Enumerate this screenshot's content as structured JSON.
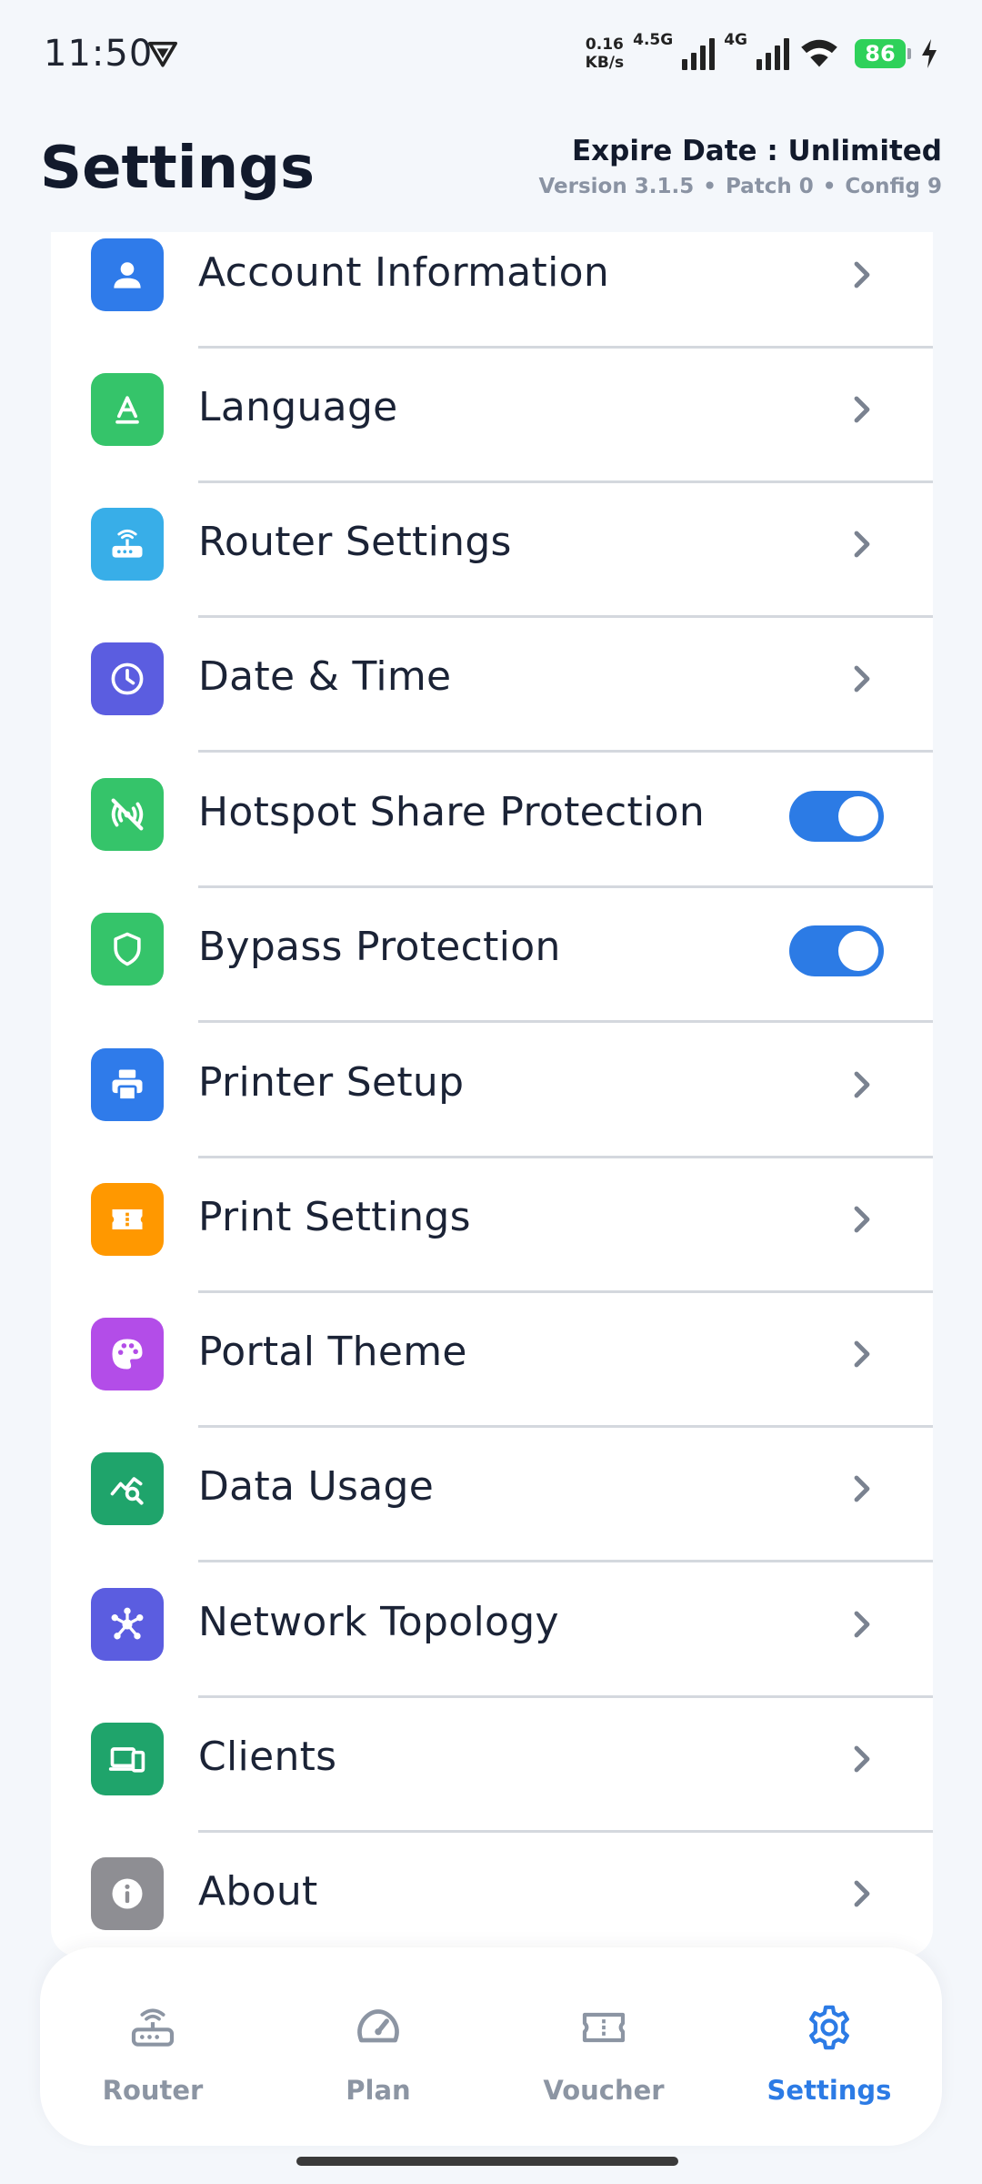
{
  "status_bar": {
    "time": "11:50",
    "net_speed_value": "0.16",
    "net_speed_unit": "KB/s",
    "signal1_label": "4.5G",
    "signal2_label": "4G",
    "battery_level": "86"
  },
  "header": {
    "title": "Settings",
    "expire": "Expire Date : Unlimited",
    "version": "Version 3.1.5",
    "patch": "Patch 0",
    "config": "Config 9",
    "separator": "•"
  },
  "settings": {
    "items": [
      {
        "label": "Account Information",
        "icon": "person-icon",
        "color": "#2f7bea",
        "control": "chevron"
      },
      {
        "label": "Language",
        "icon": "language-icon",
        "color": "#35c46a",
        "control": "chevron"
      },
      {
        "label": "Router Settings",
        "icon": "router-icon",
        "color": "#38aee8",
        "control": "chevron"
      },
      {
        "label": "Date & Time",
        "icon": "clock-icon",
        "color": "#5b5de0",
        "control": "chevron"
      },
      {
        "label": "Hotspot Share Protection",
        "icon": "hotspot-off-icon",
        "color": "#35c46a",
        "control": "toggle",
        "enabled": true
      },
      {
        "label": "Bypass Protection",
        "icon": "shield-icon",
        "color": "#35c46a",
        "control": "toggle",
        "enabled": true
      },
      {
        "label": "Printer Setup",
        "icon": "printer-icon",
        "color": "#2f7bea",
        "control": "chevron"
      },
      {
        "label": "Print Settings",
        "icon": "ticket-icon",
        "color": "#ff9800",
        "control": "chevron"
      },
      {
        "label": "Portal Theme",
        "icon": "palette-icon",
        "color": "#b34de8",
        "control": "chevron"
      },
      {
        "label": "Data Usage",
        "icon": "data-usage-icon",
        "color": "#1fa46b",
        "control": "chevron"
      },
      {
        "label": "Network Topology",
        "icon": "topology-icon",
        "color": "#5b5de0",
        "control": "chevron"
      },
      {
        "label": "Clients",
        "icon": "devices-icon",
        "color": "#1fa46b",
        "control": "chevron"
      },
      {
        "label": "About",
        "icon": "info-icon",
        "color": "#8e8e93",
        "control": "chevron"
      }
    ]
  },
  "bottom_nav": {
    "items": [
      {
        "label": "Router",
        "icon": "router-icon",
        "active": false
      },
      {
        "label": "Plan",
        "icon": "speedometer-icon",
        "active": false
      },
      {
        "label": "Voucher",
        "icon": "ticket-icon",
        "active": false
      },
      {
        "label": "Settings",
        "icon": "gear-icon",
        "active": true
      }
    ],
    "active_color": "#2c7be5",
    "inactive_color": "#8c95a3"
  }
}
